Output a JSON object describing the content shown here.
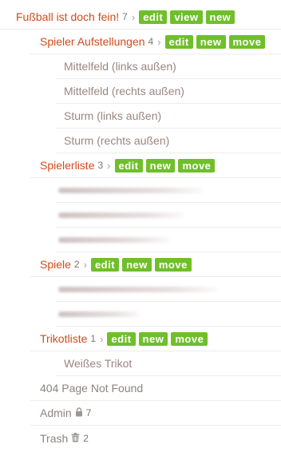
{
  "tree": {
    "root": {
      "title": "Fußball ist doch fein!",
      "count": "7",
      "actions": [
        "edit",
        "view",
        "new"
      ]
    },
    "aufstellungen": {
      "title": "Spieler Aufstellungen",
      "count": "4",
      "actions": [
        "edit",
        "new",
        "move"
      ],
      "children": [
        "Mittelfeld (links außen)",
        "Mittelfeld (rechts außen)",
        "Sturm (links außen)",
        "Sturm (rechts außen)"
      ]
    },
    "spielerliste": {
      "title": "Spielerliste",
      "count": "3",
      "actions": [
        "edit",
        "new",
        "move"
      ]
    },
    "spiele": {
      "title": "Spiele",
      "count": "2",
      "actions": [
        "edit",
        "new",
        "move"
      ]
    },
    "trikotliste": {
      "title": "Trikotliste",
      "count": "1",
      "actions": [
        "edit",
        "new",
        "move"
      ],
      "children": [
        "Weißes Trikot"
      ]
    },
    "not_found": {
      "title": "404 Page Not Found"
    },
    "admin": {
      "title": "Admin",
      "icon": "lock-icon",
      "count": "7"
    },
    "trash": {
      "title": "Trash",
      "icon": "trash-icon",
      "count": "2"
    }
  },
  "colors": {
    "title": "#d24a1c",
    "button": "#6fbf2a",
    "leaf": "#9b8581"
  }
}
